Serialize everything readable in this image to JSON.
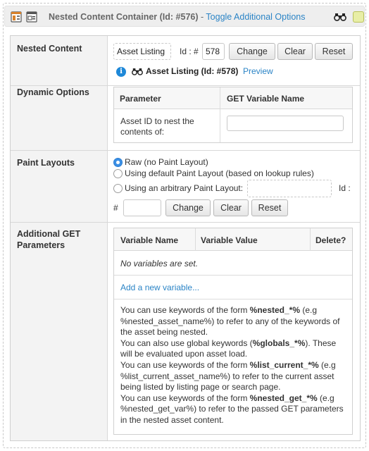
{
  "header": {
    "title": "Nested Content Container (Id: #576)",
    "separator": " - ",
    "toggle_label": "Toggle Additional Options",
    "icons": [
      "asset-template-icon",
      "asset-calendar-icon",
      "binoculars-icon",
      "status-square-icon"
    ],
    "status_color": "#e8eea6"
  },
  "nested_content": {
    "label": "Nested Content",
    "asset_value": "Asset Listing",
    "id_label": "Id : #",
    "id_value": "578",
    "change_label": "Change",
    "clear_label": "Clear",
    "reset_label": "Reset",
    "asset_info": "Asset Listing (Id: #578)",
    "preview_label": "Preview"
  },
  "dynamic_options": {
    "label": "Dynamic Options",
    "col_parameter": "Parameter",
    "col_get_variable": "GET Variable Name",
    "param_line1": "Asset ID to nest the",
    "param_line2": "contents of:",
    "get_value": ""
  },
  "paint_layouts": {
    "label": "Paint Layouts",
    "options": [
      "Raw (no Paint Layout)",
      "Using default Paint Layout (based on lookup rules)",
      "Using an arbitrary Paint Layout:"
    ],
    "selected_index": 0,
    "id_label": "Id :",
    "hash_label": "#",
    "arbitrary_value": "",
    "id_value": "",
    "change_label": "Change",
    "clear_label": "Clear",
    "reset_label": "Reset"
  },
  "additional_get": {
    "label_line1": "Additional GET",
    "label_line2": "Parameters",
    "col_name": "Variable Name",
    "col_value": "Variable Value",
    "col_delete": "Delete?",
    "empty_text": "No variables are set.",
    "add_label": "Add a new variable...",
    "help": {
      "p1_a": "You can use keywords of the form ",
      "p1_kw": "%nested_*%",
      "p1_b": " (e.g",
      "p1_c": "%nested_asset_name%) to refer to any of the keywords of",
      "p1_d": "the asset being nested.",
      "p2_a": "You can also use global keywords (",
      "p2_kw": "%globals_*%",
      "p2_b": "). These",
      "p2_c": "will be evaluated upon asset load.",
      "p3_a": "You can use keywords of the form ",
      "p3_kw": "%list_current_*%",
      "p3_b": " (e.g",
      "p3_c": "%list_current_asset_name%) to refer to the current asset",
      "p3_d": "being listed by listing page or search page.",
      "p4_a": "You can use keywords of the form ",
      "p4_kw": "%nested_get_*%",
      "p4_b": " (e.g",
      "p4_c": "%nested_get_var%) to refer to the passed GET parameters",
      "p4_d": "in the nested asset content."
    }
  }
}
